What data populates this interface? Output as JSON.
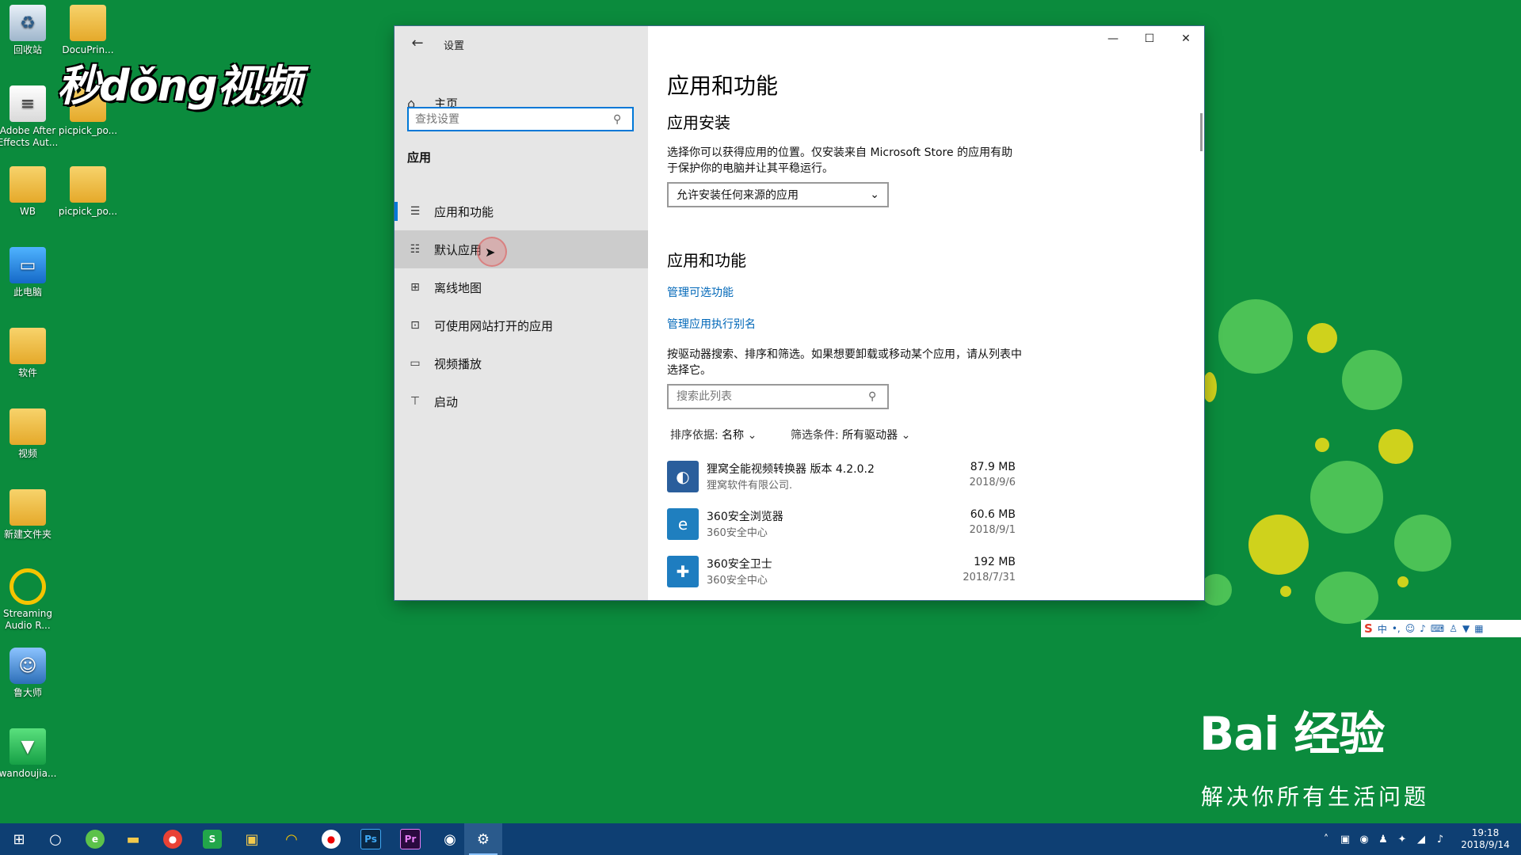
{
  "desktop": {
    "icons": [
      {
        "label": "回收站"
      },
      {
        "label": "DocuPrin..."
      },
      {
        "label": "Adobe After Effects Aut..."
      },
      {
        "label": "picpick_po..."
      },
      {
        "label": "WB"
      },
      {
        "label": "picpick_po..."
      },
      {
        "label": "此电脑"
      },
      {
        "label": "软件"
      },
      {
        "label": "视频"
      },
      {
        "label": "新建文件夹"
      },
      {
        "label": "Streaming Audio R..."
      },
      {
        "label": "鲁大师"
      },
      {
        "label": "wandoujia..."
      }
    ],
    "watermark": "秒dǒng视频",
    "brand": {
      "logo_text": "Bai 经验",
      "slogan": "解决你所有生活问题"
    }
  },
  "window": {
    "title": "设置",
    "back_glyph": "←",
    "controls": {
      "minimize": "—",
      "maximize": "☐",
      "close": "✕"
    },
    "sidebar": {
      "home_label": "主页",
      "search_placeholder": "查找设置",
      "section_label": "应用",
      "items": [
        {
          "label": "应用和功能",
          "icon": "list-icon"
        },
        {
          "label": "默认应用",
          "icon": "default-apps-icon"
        },
        {
          "label": "离线地图",
          "icon": "map-icon"
        },
        {
          "label": "可使用网站打开的应用",
          "icon": "web-app-icon"
        },
        {
          "label": "视频播放",
          "icon": "video-icon"
        },
        {
          "label": "启动",
          "icon": "startup-icon"
        }
      ]
    },
    "main": {
      "page_title": "应用和功能",
      "install_heading": "应用安装",
      "install_desc": "选择你可以获得应用的位置。仅安装来自 Microsoft Store 的应用有助于保护你的电脑并让其平稳运行。",
      "install_dropdown": "允许安装任何来源的应用",
      "apps_heading": "应用和功能",
      "link_optional": "管理可选功能",
      "link_alias": "管理应用执行别名",
      "list_desc": "按驱动器搜索、排序和筛选。如果想要卸载或移动某个应用，请从列表中选择它。",
      "list_search_placeholder": "搜索此列表",
      "sort_label": "排序依据:",
      "sort_value": "名称",
      "filter_label": "筛选条件:",
      "filter_value": "所有驱动器",
      "apps": [
        {
          "name": "狸窝全能视频转换器 版本 4.2.0.2",
          "publisher": "狸窝软件有限公司.",
          "size": "87.9 MB",
          "date": "2018/9/6",
          "color": "#1f6fb0"
        },
        {
          "name": "360安全浏览器",
          "publisher": "360安全中心",
          "size": "60.6 MB",
          "date": "2018/9/1",
          "color": "#1e9b3a"
        },
        {
          "name": "360安全卫士",
          "publisher": "360安全中心",
          "size": "192 MB",
          "date": "2018/7/31",
          "color": "#1e9b3a"
        }
      ]
    }
  },
  "ime": {
    "logo": "S",
    "mode": "中"
  },
  "taskbar": {
    "clock_time": "19:18",
    "clock_date": "2018/9/14"
  }
}
